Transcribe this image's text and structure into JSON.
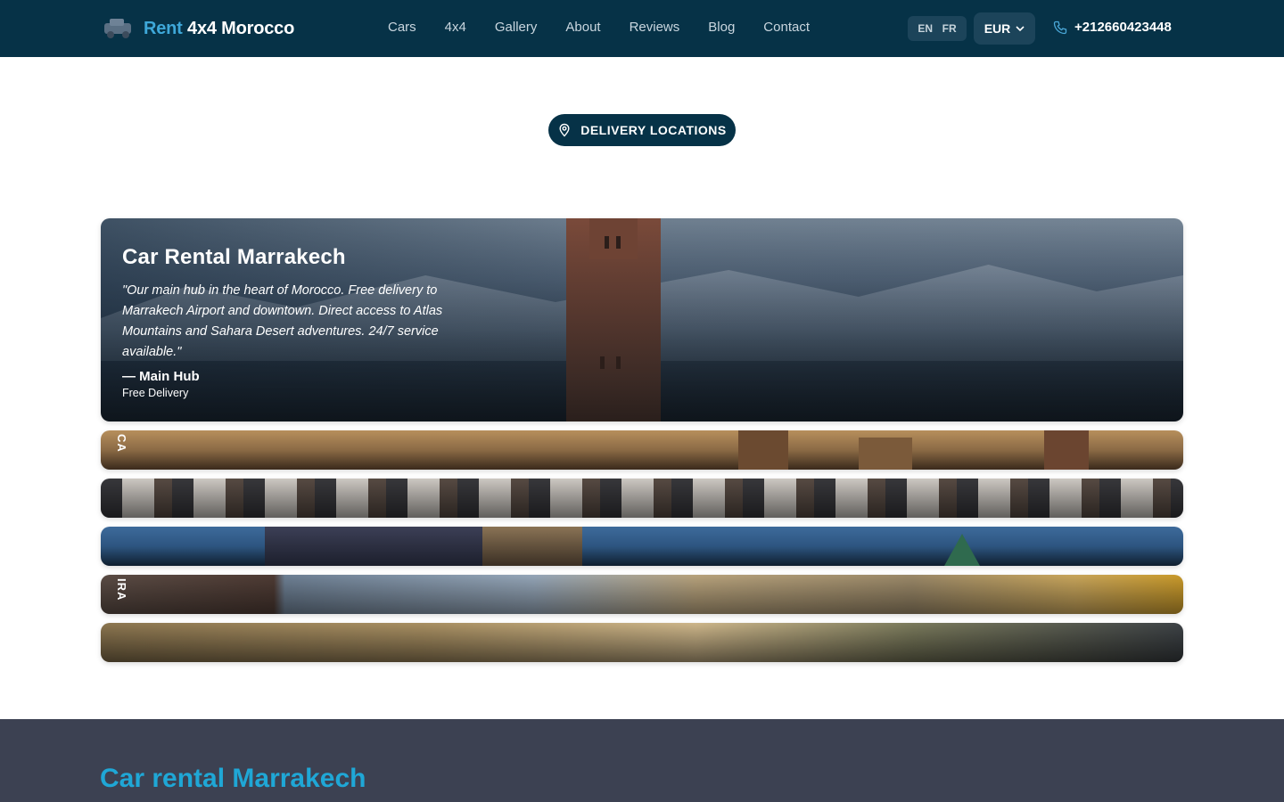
{
  "brand": {
    "rent": "Rent",
    "rest": "4x4 Morocco",
    "icon": "car-icon"
  },
  "nav": [
    "Cars",
    "4x4",
    "Gallery",
    "About",
    "Reviews",
    "Blog",
    "Contact"
  ],
  "lang": {
    "en": "EN",
    "fr": "FR"
  },
  "currency": {
    "value": "EUR",
    "icon": "chevron-down-icon"
  },
  "phone": {
    "number": "+212660423448",
    "icon": "phone-icon"
  },
  "pill": {
    "label": "DELIVERY LOCATIONS",
    "icon": "location-pin-icon"
  },
  "featured": {
    "title": "Car Rental Marrakech",
    "quote": "\"Our main hub in the heart of Morocco. Free delivery to Marrakech Airport and downtown. Direct access to Atlas Mountains and Sahara Desert adventures. 24/7 service available.\"",
    "author": "— Main Hub",
    "sub": "Free Delivery"
  },
  "strips": [
    {
      "label": "CA"
    },
    {
      "label": ""
    },
    {
      "label": ""
    },
    {
      "label": "IRA"
    },
    {
      "label": ""
    }
  ],
  "section": {
    "title": "Car rental Marrakech"
  },
  "colors": {
    "header": "#063247",
    "accent": "#3ea8d9",
    "section_bg": "#3c4152",
    "section_title": "#1fa7d6"
  }
}
